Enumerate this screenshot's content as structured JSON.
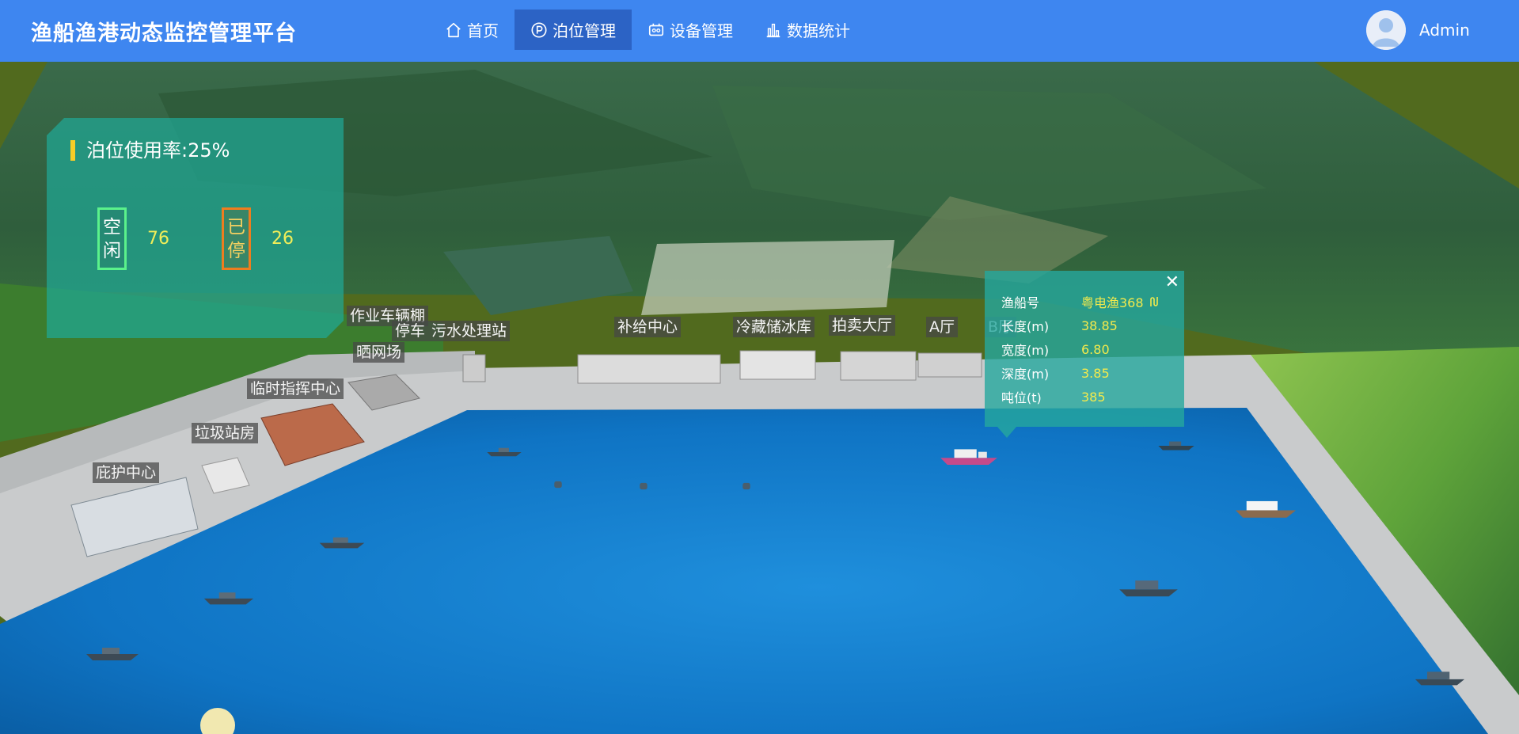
{
  "app": {
    "title": "渔船渔港动态监控管理平台"
  },
  "nav": {
    "items": [
      {
        "label": "首页",
        "icon": "home-icon"
      },
      {
        "label": "泊位管理",
        "icon": "parking-icon",
        "active": true
      },
      {
        "label": "设备管理",
        "icon": "device-icon"
      },
      {
        "label": "数据统计",
        "icon": "bar-chart-icon"
      }
    ]
  },
  "user": {
    "name": "Admin",
    "icon": "user-avatar-icon"
  },
  "berth": {
    "title": "泊位使用率:25%",
    "idle_label_1": "空",
    "idle_label_2": "闲",
    "idle_value": "76",
    "used_label_1": "已",
    "used_label_2": "停",
    "used_value": "26"
  },
  "vessel": {
    "rows": [
      {
        "key": "渔船号",
        "value": "粤电渔368"
      },
      {
        "key": "长度(m)",
        "value": "38.85"
      },
      {
        "key": "宽度(m)",
        "value": "6.80"
      },
      {
        "key": "深度(m)",
        "value": "3.85"
      },
      {
        "key": "吨位(t)",
        "value": "385"
      }
    ],
    "close": "✕",
    "track_icon": "track-icon"
  },
  "map_labels": {
    "work_shed": "作业车辆棚",
    "parking": "停车",
    "sewage": "污水处理站",
    "net_drying": "晒网场",
    "supply": "补给中心",
    "cold_storage": "冷藏储冰库",
    "auction": "拍卖大厅",
    "hall_a": "A厅",
    "hall_b": "B厅",
    "temp_command": "临时指挥中心",
    "garbage": "垃圾站房",
    "shelter": "庇护中心"
  },
  "colors": {
    "header": "#3e86f0",
    "nav_active": "#2c63c5",
    "panel": "#20a896",
    "value_yellow": "#f2ee58",
    "idle_border": "#5bf28b",
    "used_border": "#ef7d1e"
  }
}
